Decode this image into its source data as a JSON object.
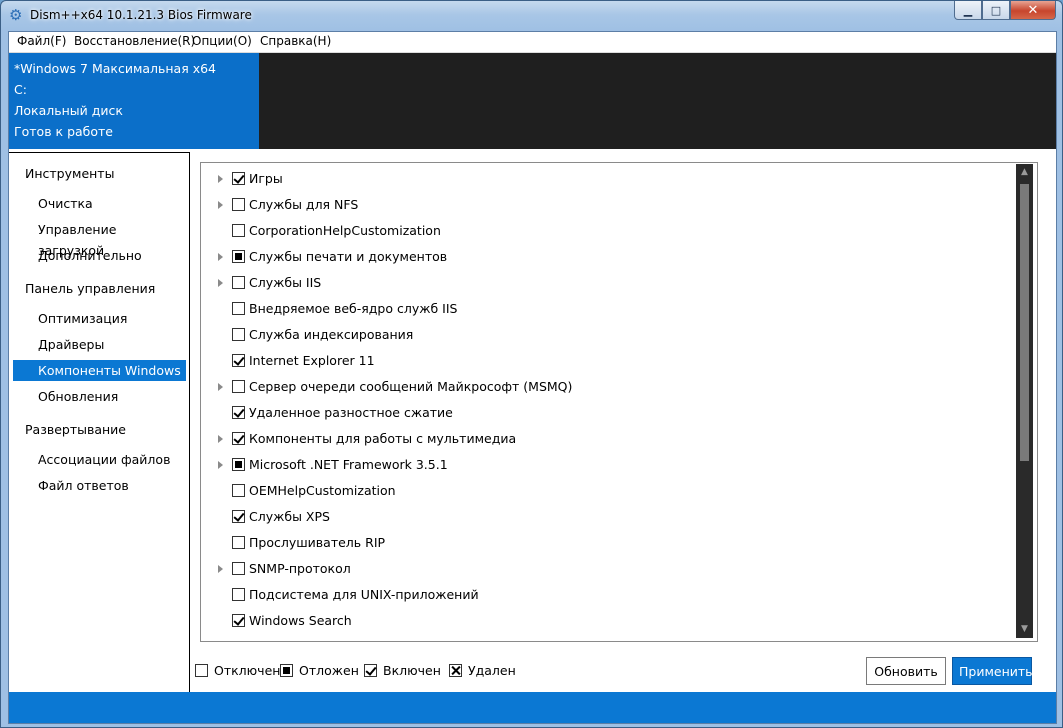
{
  "window": {
    "title": "Dism++x64 10.1.21.3 Bios Firmware"
  },
  "menu": [
    "Файл(F)",
    "Восстановление(R)",
    "Опции(O)",
    "Справка(H)"
  ],
  "header": {
    "lines": [
      "*Windows 7 Максимальная x64",
      "C:",
      "Локальный диск",
      "Готов к работе"
    ]
  },
  "sidebar": {
    "groups": [
      {
        "label": "Инструменты",
        "items": [
          "Очистка",
          "Управление загрузкой",
          "Дополнительно"
        ]
      },
      {
        "label": "Панель управления",
        "items": [
          "Оптимизация",
          "Драйверы",
          "Компоненты Windows",
          "Обновления"
        ]
      },
      {
        "label": "Развертывание",
        "items": [
          "Ассоциации файлов",
          "Файл ответов"
        ]
      }
    ],
    "active_item": "Компоненты Windows"
  },
  "features": [
    {
      "label": "Игры",
      "state": "checked",
      "expandable": true
    },
    {
      "label": "Службы для NFS",
      "state": "unchecked",
      "expandable": true
    },
    {
      "label": "CorporationHelpCustomization",
      "state": "unchecked",
      "expandable": false
    },
    {
      "label": "Службы печати и документов",
      "state": "partial",
      "expandable": true
    },
    {
      "label": "Службы IIS",
      "state": "unchecked",
      "expandable": true
    },
    {
      "label": "Внедряемое веб-ядро служб IIS",
      "state": "unchecked",
      "expandable": false
    },
    {
      "label": "Служба индексирования",
      "state": "unchecked",
      "expandable": false
    },
    {
      "label": "Internet Explorer 11",
      "state": "checked",
      "expandable": false
    },
    {
      "label": "Сервер очереди сообщений Майкрософт (MSMQ)",
      "state": "unchecked",
      "expandable": true
    },
    {
      "label": "Удаленное разностное сжатие",
      "state": "checked",
      "expandable": false
    },
    {
      "label": "Компоненты для работы с мультимедиа",
      "state": "checked",
      "expandable": true
    },
    {
      "label": "Microsoft .NET Framework 3.5.1",
      "state": "partial",
      "expandable": true
    },
    {
      "label": "OEMHelpCustomization",
      "state": "unchecked",
      "expandable": false
    },
    {
      "label": "Службы XPS",
      "state": "checked",
      "expandable": false
    },
    {
      "label": "Прослушиватель RIP",
      "state": "unchecked",
      "expandable": false
    },
    {
      "label": "SNMP-протокол",
      "state": "unchecked",
      "expandable": true
    },
    {
      "label": "Подсистема для UNIX-приложений",
      "state": "unchecked",
      "expandable": false
    },
    {
      "label": "Windows Search",
      "state": "checked",
      "expandable": false
    }
  ],
  "legend": [
    {
      "label": "Отключен",
      "state": "unchecked"
    },
    {
      "label": "Отложен",
      "state": "partial"
    },
    {
      "label": "Включен",
      "state": "checked"
    },
    {
      "label": "Удален",
      "state": "removed"
    }
  ],
  "buttons": {
    "refresh": "Обновить",
    "apply": "Применить"
  },
  "colors": {
    "accent": "#0b78d3",
    "header_blue": "#0b6fc9",
    "header_dark": "#1f1f1f"
  }
}
